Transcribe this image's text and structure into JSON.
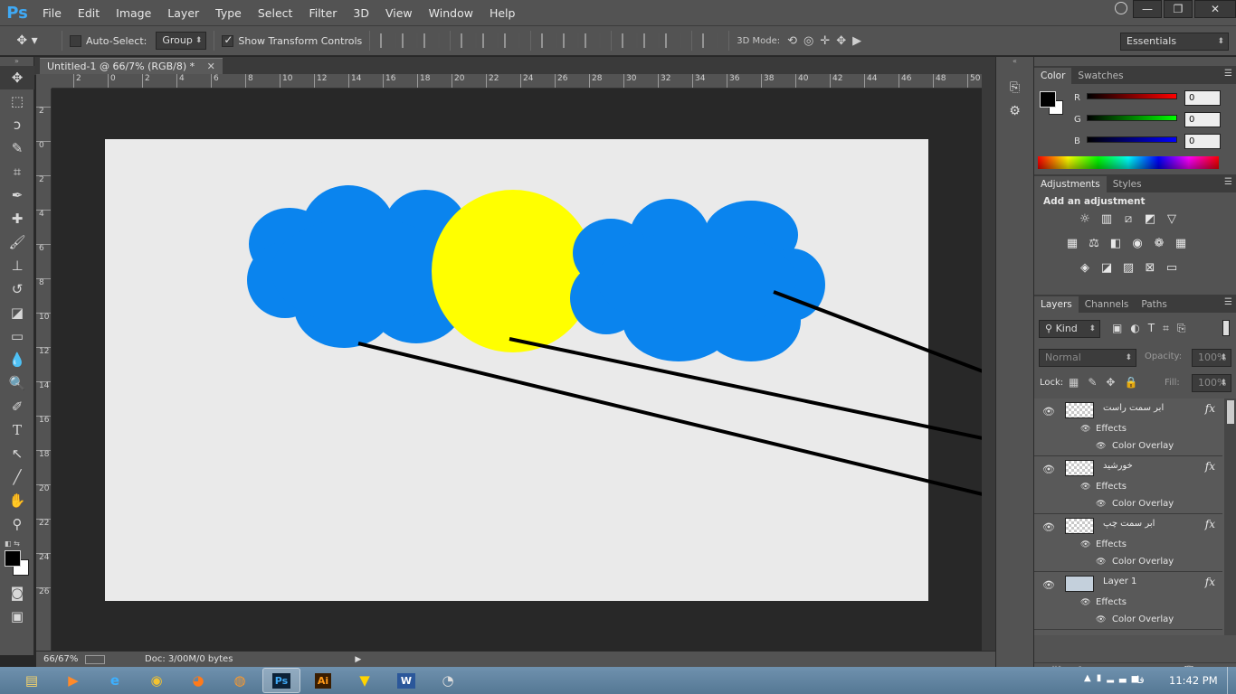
{
  "app": {
    "logo": "Ps",
    "colors": {
      "ui_dark": "#535353",
      "canvas_bg": "#eaeaea",
      "cloud": "#0a84ee",
      "sun": "#ffff00",
      "accent": "#3fa9f5"
    }
  },
  "menu": [
    "File",
    "Edit",
    "Image",
    "Layer",
    "Type",
    "Select",
    "Filter",
    "3D",
    "View",
    "Window",
    "Help"
  ],
  "window_controls": [
    "minimize-icon",
    "restore-icon",
    "close-icon"
  ],
  "options": {
    "auto_select_label": "Auto-Select:",
    "auto_select_checked": false,
    "group_value": "Group",
    "show_transform_label": "Show Transform Controls",
    "show_transform_checked": true,
    "mode3d_label": "3D Mode:",
    "workspace": "Essentials"
  },
  "tools": [
    "move-tool-icon",
    "marquee-tool-icon",
    "lasso-tool-icon",
    "quick-select-tool-icon",
    "crop-tool-icon",
    "eyedropper-tool-icon",
    "healing-brush-tool-icon",
    "brush-tool-icon",
    "clone-stamp-tool-icon",
    "history-brush-tool-icon",
    "eraser-tool-icon",
    "gradient-tool-icon",
    "blur-tool-icon",
    "dodge-tool-icon",
    "pen-tool-icon",
    "type-tool-icon",
    "path-select-tool-icon",
    "line-tool-icon",
    "hand-tool-icon",
    "zoom-tool-icon"
  ],
  "document": {
    "tab_title": "Untitled-1 @ 66/7% (RGB/8) *",
    "ruler_h": [
      "2",
      "0",
      "2",
      "4",
      "6",
      "8",
      "10",
      "12",
      "14",
      "16",
      "18",
      "20",
      "22",
      "24",
      "26",
      "28",
      "30",
      "32",
      "34",
      "36",
      "38",
      "40",
      "42",
      "44",
      "46",
      "48",
      "50"
    ],
    "ruler_v": [
      "2",
      "0",
      "2",
      "4",
      "6",
      "8",
      "10",
      "12",
      "14",
      "16",
      "18",
      "20",
      "22",
      "24",
      "26"
    ]
  },
  "status": {
    "zoom": "66/67%",
    "doc": "Doc: 3/00M/0 bytes"
  },
  "color_panel": {
    "tabs": [
      "Color",
      "Swatches"
    ],
    "channels": [
      {
        "name": "R",
        "value": "0"
      },
      {
        "name": "G",
        "value": "0"
      },
      {
        "name": "B",
        "value": "0"
      }
    ]
  },
  "adjustments_panel": {
    "tabs": [
      "Adjustments",
      "Styles"
    ],
    "heading": "Add an adjustment"
  },
  "layers_panel": {
    "tabs": [
      "Layers",
      "Channels",
      "Paths"
    ],
    "kind_label": "Kind",
    "blend_mode": "Normal",
    "opacity_label": "Opacity:",
    "opacity_value": "100%",
    "lock_label": "Lock:",
    "fill_label": "Fill:",
    "fill_value": "100%",
    "effects_label": "Effects",
    "overlay_label": "Color Overlay",
    "fx_label": "fx",
    "layers": [
      {
        "name": "ابر سمت راست"
      },
      {
        "name": "خورشید"
      },
      {
        "name": "ابر سمت چپ"
      },
      {
        "name": "Layer 1"
      }
    ]
  },
  "taskbar": {
    "apps": [
      "explorer-icon",
      "media-player-icon",
      "ie-icon",
      "chrome-icon",
      "firefox-icon",
      "blender-icon",
      "photoshop-icon",
      "illustrator-icon",
      "norton-icon",
      "word-icon",
      "other-app-icon"
    ],
    "app_labels": {
      "photoshop": "Ps",
      "illustrator": "Ai",
      "word": "W"
    },
    "lang": "فا",
    "time": "11:42 PM"
  }
}
